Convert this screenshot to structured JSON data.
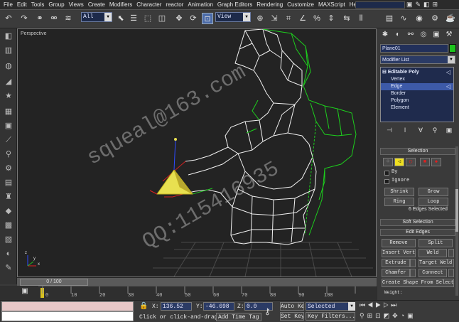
{
  "menu": [
    "File",
    "Edit",
    "Tools",
    "Group",
    "Views",
    "Create",
    "Modifiers",
    "Character",
    "reactor",
    "Animation",
    "Graph Editors",
    "Rendering",
    "Customize",
    "MAXScript",
    "Help"
  ],
  "toolbar": {
    "selection_filter": "All",
    "ref_coord": "View"
  },
  "viewport": {
    "label": "Perspective",
    "watermark1": "squeal@163.com",
    "watermark2": "QQ:115416935",
    "axis_x": "x",
    "axis_y": "y",
    "axis_z": "z"
  },
  "panel": {
    "object_name": "Plane01",
    "object_color": "#1dc41d",
    "modifier_list": "Modifier List",
    "stack": [
      {
        "label": "Editable Poly",
        "sel": false,
        "head": true
      },
      {
        "label": "Vertex",
        "sel": false
      },
      {
        "label": "Edge",
        "sel": true
      },
      {
        "label": "Border",
        "sel": false
      },
      {
        "label": "Polygon",
        "sel": false
      },
      {
        "label": "Element",
        "sel": false
      }
    ],
    "selection_title": "Selection",
    "by_label": "By",
    "ignore_label": "Ignore",
    "shrink": "Shrink",
    "grow": "Grow",
    "ring": "Ring",
    "loop": "Loop",
    "sel_count": "6 Edges Selected",
    "soft_selection": "Soft Selection",
    "edit_edges": "Edit Edges",
    "remove": "Remove",
    "split": "Split",
    "insert_vertex": "Insert Vertex",
    "weld": "Weld",
    "extrude": "Extrude",
    "target_weld": "Target Weld",
    "chamfer": "Chamfer",
    "connect": "Connect",
    "create_shape": "Create Shape From Selection",
    "weight": "Weight:"
  },
  "time": {
    "slider_text": "0 / 100",
    "ticks": [
      "0",
      "10",
      "20",
      "30",
      "40",
      "50",
      "60",
      "70",
      "80",
      "90",
      "100"
    ]
  },
  "status": {
    "x_label": "X:",
    "x_val": "136.52",
    "y_label": "Y:",
    "y_val": "-46.698",
    "z_label": "Z:",
    "z_val": "0.0",
    "auto_key": "Auto Key",
    "selected": "Selected",
    "set_key": "Set Key",
    "key_filters": "Key Filters...",
    "prompt": "Click or click-and-drag",
    "add_time_tag": "Add Time Tag"
  }
}
